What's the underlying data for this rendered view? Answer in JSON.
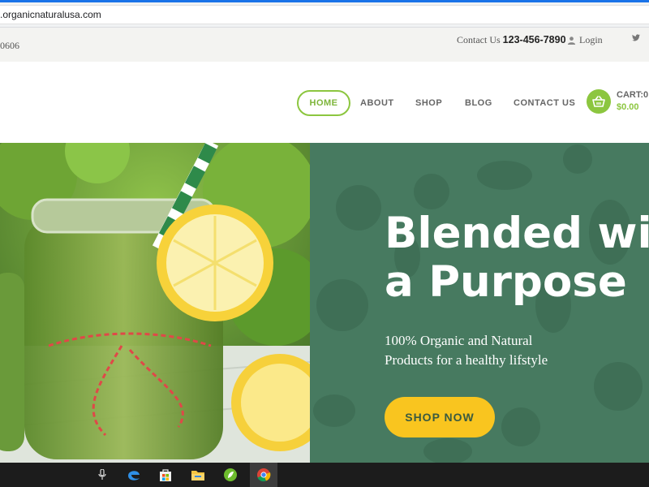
{
  "browser": {
    "url": ".organicnaturalusa.com"
  },
  "topbar": {
    "phone_fragment": "0606",
    "contact_label": "Contact Us",
    "contact_phone": "123-456-7890",
    "login_label": "Login"
  },
  "nav": {
    "items": [
      "HOME",
      "ABOUT",
      "SHOP",
      "BLOG",
      "CONTACT US"
    ],
    "active": "HOME"
  },
  "cart": {
    "label": "CART:0",
    "amount": "$0.00"
  },
  "hero": {
    "title_line1": "Blended with",
    "title_line2": "a Purpose",
    "subtitle_line1": "100% Organic and Natural",
    "subtitle_line2": "Products for a healthy lifstyle",
    "cta": "SHOP NOW"
  },
  "colors": {
    "accent_green": "#8cc63f",
    "panel_green": "#477a60",
    "cta_yellow": "#f9c51f"
  },
  "taskbar": {
    "icons": [
      "microphone-icon",
      "edge-icon",
      "store-icon",
      "file-explorer-icon",
      "app-icon",
      "chrome-icon"
    ]
  }
}
